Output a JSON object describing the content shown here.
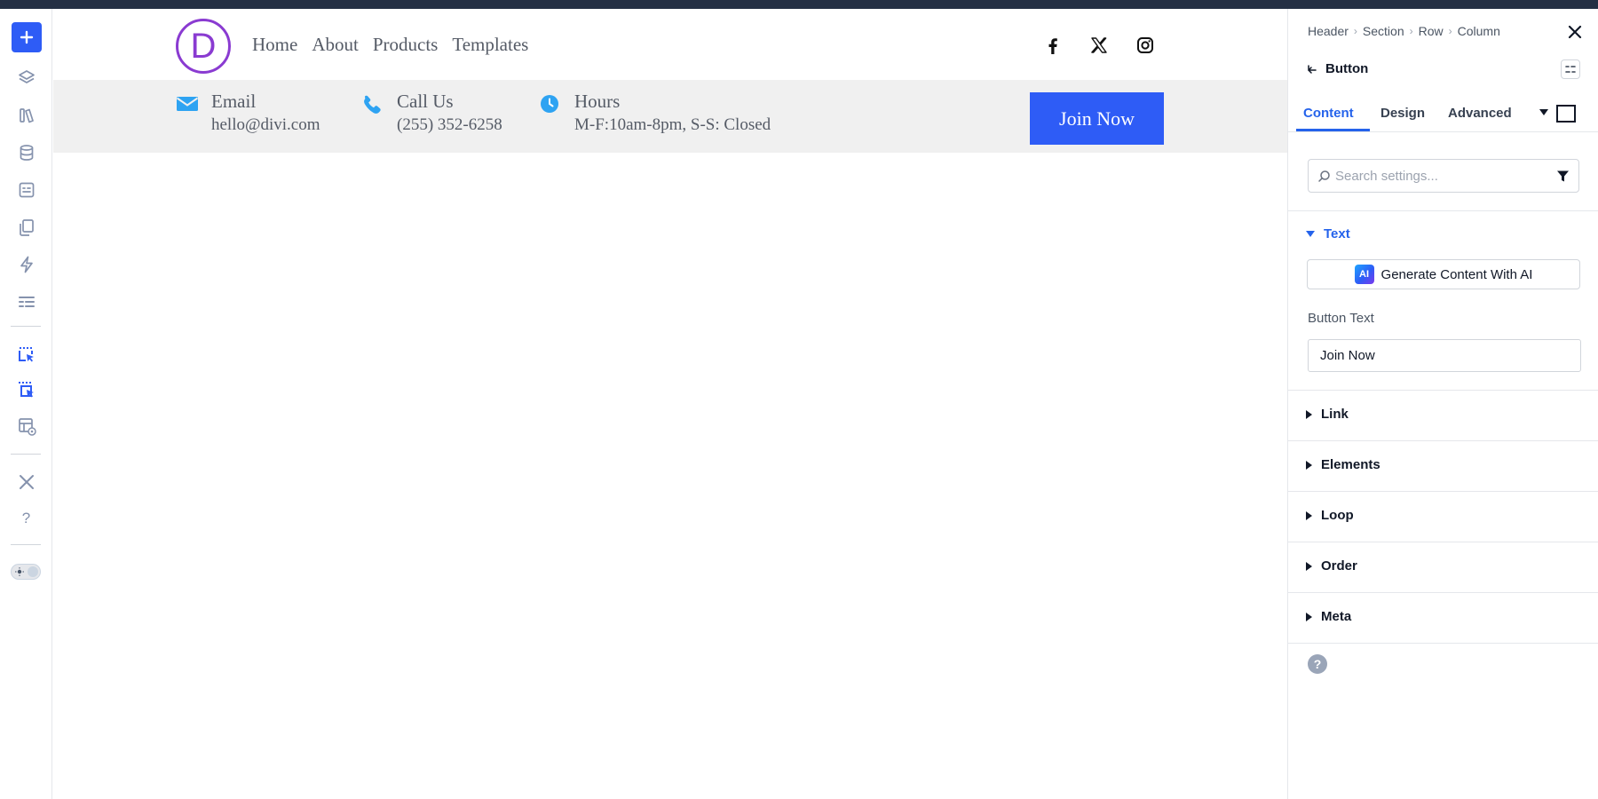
{
  "site": {
    "logo_letter": "D",
    "nav": [
      "Home",
      "About",
      "Products",
      "Templates"
    ],
    "info": [
      {
        "label": "Email",
        "value": "hello@divi.com",
        "icon": "envelope-icon"
      },
      {
        "label": "Call Us",
        "value": "(255) 352-6258",
        "icon": "phone-icon"
      },
      {
        "label": "Hours",
        "value": "M-F:10am-8pm, S-S: Closed",
        "icon": "clock-icon"
      }
    ],
    "cta": "Join Now",
    "social": [
      "facebook-icon",
      "x-icon",
      "instagram-icon"
    ],
    "colors": {
      "accent": "#2e5cf6",
      "logo": "#8a3bd1",
      "info_icon": "#2ea3f2"
    }
  },
  "panel": {
    "breadcrumbs": [
      "Header",
      "Section",
      "Row",
      "Column"
    ],
    "module": "Button",
    "tabs": [
      "Content",
      "Design",
      "Advanced"
    ],
    "active_tab": "Content",
    "search_placeholder": "Search settings...",
    "text_group": {
      "title": "Text",
      "ai_button": "Generate Content With AI",
      "ai_badge": "AI",
      "field_label": "Button Text",
      "field_value": "Join Now"
    },
    "groups": [
      "Link",
      "Elements",
      "Loop",
      "Order",
      "Meta"
    ],
    "help": "?"
  },
  "leftbar": {
    "icons": [
      "plus-icon",
      "layers-icon",
      "library-icon",
      "database-icon",
      "form-icon",
      "pages-icon",
      "lightning-icon",
      "list-icon",
      "select-module-icon",
      "select-multiple-icon",
      "template-preview-icon",
      "tools-icon",
      "help-icon",
      "theme-toggle"
    ],
    "help_label": "?"
  }
}
